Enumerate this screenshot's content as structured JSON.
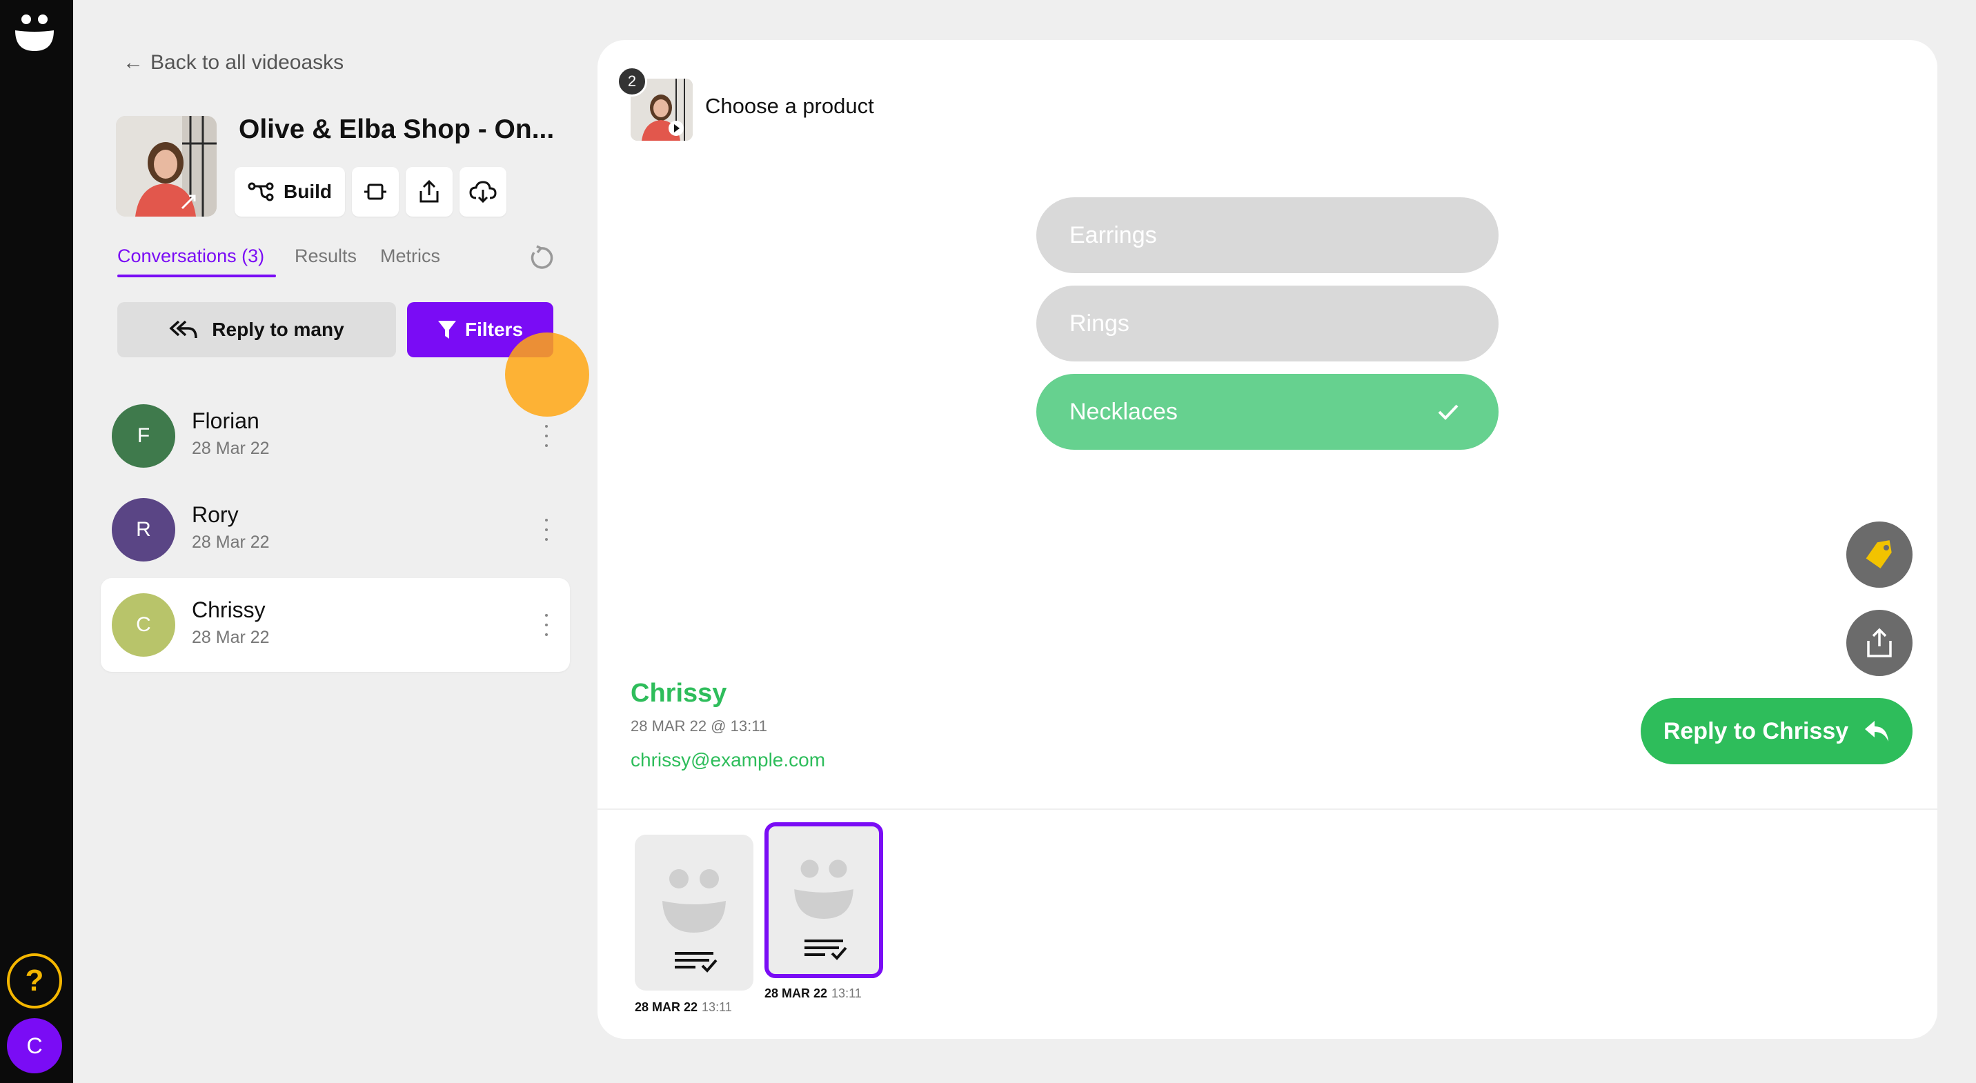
{
  "sidebar": {
    "back_label": "Back to all videoasks",
    "survey_title": "Olive & Elba Shop - On...",
    "build_label": "Build",
    "tabs": [
      {
        "label": "Conversations (3)",
        "active": true
      },
      {
        "label": "Results",
        "active": false
      },
      {
        "label": "Metrics",
        "active": false
      }
    ],
    "reply_many_label": "Reply to many",
    "filters_label": "Filters",
    "conversations": [
      {
        "initial": "F",
        "name": "Florian",
        "date": "28 Mar 22",
        "color": "#3f7a4c",
        "selected": false
      },
      {
        "initial": "R",
        "name": "Rory",
        "date": "28 Mar 22",
        "color": "#5a4585",
        "selected": false
      },
      {
        "initial": "C",
        "name": "Chrissy",
        "date": "28 Mar 22",
        "color": "#b8c46a",
        "selected": true
      }
    ]
  },
  "rail": {
    "help_label": "?",
    "user_initial": "C"
  },
  "main": {
    "step_number": "2",
    "step_title": "Choose a product",
    "choices": [
      {
        "label": "Earrings",
        "selected": false
      },
      {
        "label": "Rings",
        "selected": false
      },
      {
        "label": "Necklaces",
        "selected": true
      }
    ],
    "respondent": {
      "name": "Chrissy",
      "datetime": "28 MAR 22 @ 13:11",
      "email": "chrissy@example.com"
    },
    "reply_label": "Reply to Chrissy",
    "cards": [
      {
        "date": "28 MAR 22",
        "time": "13:11",
        "selected": false
      },
      {
        "date": "28 MAR 22",
        "time": "13:11",
        "selected": true
      }
    ]
  },
  "colors": {
    "accent": "#7a0cf5",
    "success": "#2ebd5b",
    "choice_selected": "#66d18f",
    "choice_default": "#d9d9d9",
    "rail": "#0b0b0b",
    "help": "#f5b700"
  },
  "icons": [
    "back-arrow-icon",
    "build-flow-icon",
    "embed-icon",
    "share-icon",
    "download-cloud-icon",
    "refresh-icon",
    "reply-all-icon",
    "filter-icon",
    "more-vertical-icon",
    "play-icon",
    "check-icon",
    "tag-icon",
    "share-icon",
    "reply-icon",
    "transcript-icon"
  ]
}
